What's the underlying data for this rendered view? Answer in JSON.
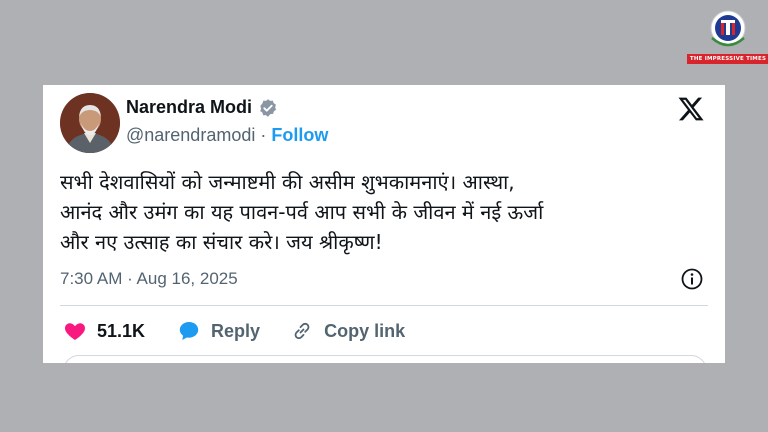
{
  "watermark": {
    "text": "THE IMPRESSIVE TIMES",
    "brand_red": "#d8242b"
  },
  "tweet": {
    "author_name": "Narendra Modi",
    "handle": "@narendramodi",
    "separator": " · ",
    "follow_label": "Follow",
    "lines": [
      "सभी देशवासियों को जन्माष्टमी की असीम शुभकामनाएं। आस्था,",
      "आनंद और उमंग का यह पावन-पर्व आप सभी के जीवन में नई ऊर्जा",
      "और नए उत्साह का संचार करे। जय श्रीकृष्ण!"
    ],
    "time": "7:30 AM",
    "date": "Aug 16, 2025",
    "likes": "51.1K",
    "reply_label": "Reply",
    "copy_label": "Copy link",
    "icons": {
      "verified": "verified-badge-icon",
      "platform": "x-logo-icon",
      "info": "info-icon",
      "like": "heart-icon",
      "reply": "reply-bubble-icon",
      "copy": "link-icon"
    },
    "colors": {
      "accent": "#1d9bf0",
      "like": "#f91880",
      "text": "#0f1419",
      "muted": "#536471"
    }
  }
}
